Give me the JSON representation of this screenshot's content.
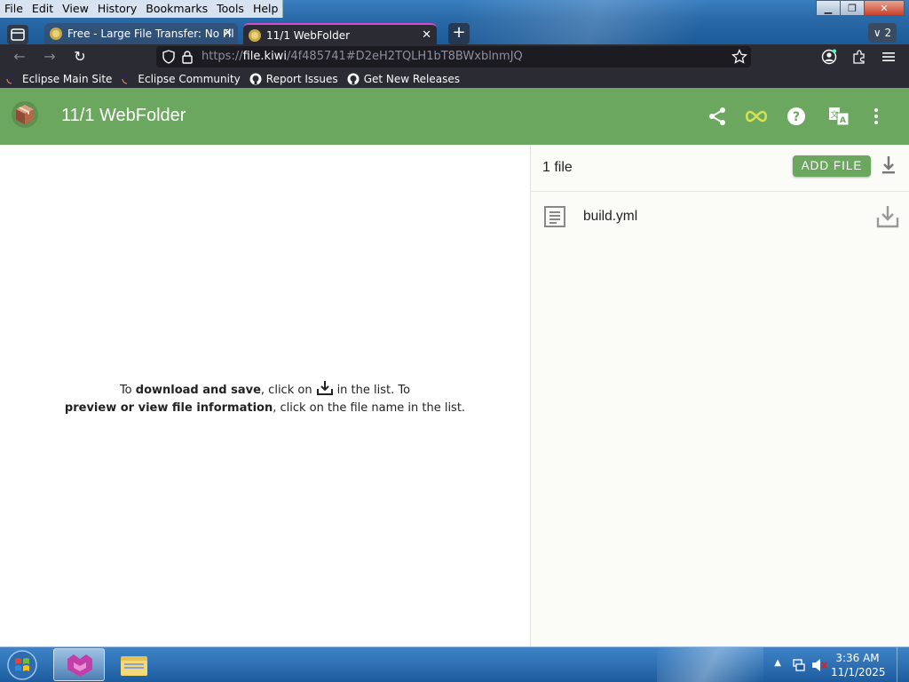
{
  "browser": {
    "menu": [
      "File",
      "Edit",
      "View",
      "History",
      "Bookmarks",
      "Tools",
      "Help"
    ],
    "tabs": [
      {
        "title": "Free - Large File Transfer: No Fil",
        "active": false
      },
      {
        "title": "11/1 WebFolder",
        "active": true
      }
    ],
    "tab_count": "2",
    "url": {
      "scheme": "https://",
      "host": "file.kiwi",
      "path": "/4f485741#D2eH2TQLH1bT8BWxblnmJQ"
    },
    "bookmarks": [
      "Eclipse Main Site",
      "Eclipse Community",
      "Report Issues",
      "Get New Releases"
    ]
  },
  "app": {
    "title": "11/1 WebFolder",
    "header_icons": [
      "share-icon",
      "infinity-icon",
      "help-icon",
      "translate-icon",
      "more-vert-icon"
    ],
    "hint": {
      "p1_before": "To ",
      "p1_bold": "download and save",
      "p1_mid": ", click on",
      "p1_after": "in the list. To",
      "p2_bold": "preview or view file information",
      "p2_after": ", click on the file name in the list."
    },
    "file_count": "1 file",
    "add_file_label": "ADD FILE",
    "files": [
      {
        "name": "build.yml"
      }
    ]
  },
  "taskbar": {
    "time": "3:36 AM",
    "date": "11/1/2025"
  },
  "colors": {
    "appbar": "#6ca75f",
    "accent_tab": "#d04bd0",
    "infinity": "#d4e157"
  }
}
